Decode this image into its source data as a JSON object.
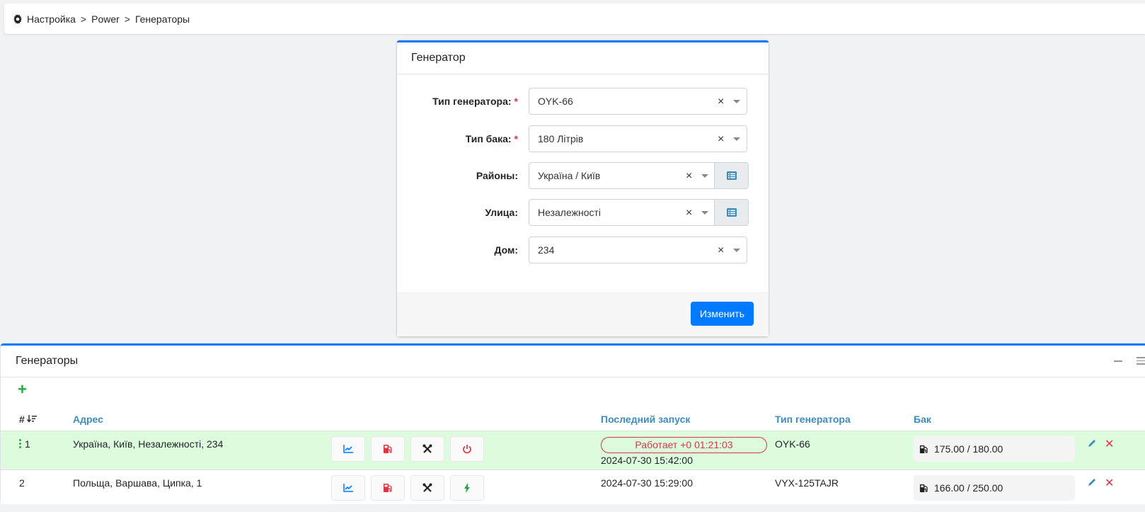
{
  "breadcrumb": {
    "items": [
      "Настройка",
      "Power",
      "Генераторы"
    ],
    "separator": ">"
  },
  "form": {
    "title": "Генератор",
    "fields": [
      {
        "label": "Тип генератора:",
        "required": true,
        "value": "OYK-66"
      },
      {
        "label": "Тип бака:",
        "required": true,
        "value": "180 Літрів"
      },
      {
        "label": "Районы:",
        "required": false,
        "value": "Україна / Київ"
      },
      {
        "label": "Улица:",
        "required": false,
        "value": "Незалежності"
      },
      {
        "label": "Дом:",
        "required": false,
        "value": "234"
      }
    ],
    "required_mark": "*",
    "clear_glyph": "×",
    "submit_label": "Изменить"
  },
  "list": {
    "title": "Генераторы",
    "columns": {
      "num": "#",
      "address": "Адрес",
      "last_start": "Последний запуск",
      "gen_type": "Тип генератора",
      "tank": "Бак"
    },
    "rows": [
      {
        "num": "1",
        "address": "Україна, Київ, Незалежності, 234",
        "status": "Работает +0 01:21:03",
        "last_start": "2024-07-30 15:42:00",
        "gen_type": "OYK-66",
        "tank": "175.00 / 180.00",
        "power_icon": "power-off-icon"
      },
      {
        "num": "2",
        "address": "Польща, Варшава, Ципка, 1",
        "status": "",
        "last_start": "2024-07-30 15:29:00",
        "gen_type": "VYX-125TAJR",
        "tank": "166.00 / 250.00",
        "power_icon": "bolt-icon"
      }
    ],
    "delete_glyph": "✕",
    "plus_glyph": "+"
  },
  "colors": {
    "primary": "#007bff",
    "link": "#3c8dbc",
    "danger": "#dc3545",
    "success": "#28a745",
    "active_row": "#ddfcdd"
  }
}
